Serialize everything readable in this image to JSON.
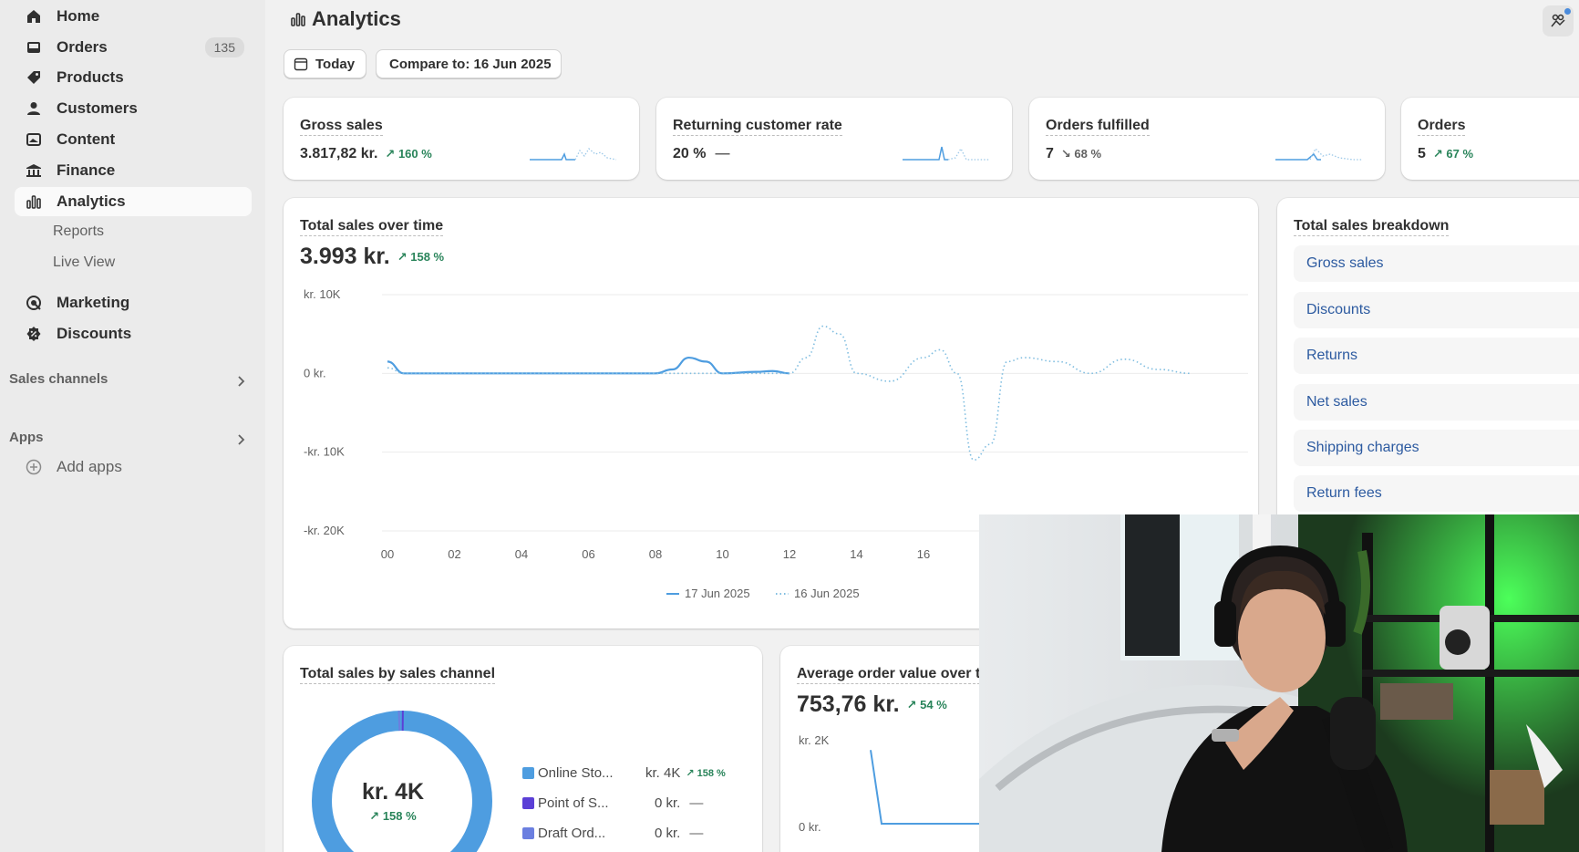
{
  "sidebar": {
    "items": [
      {
        "label": "Home",
        "icon": "home-icon"
      },
      {
        "label": "Orders",
        "icon": "inbox-icon",
        "badge": "135"
      },
      {
        "label": "Products",
        "icon": "tag-icon"
      },
      {
        "label": "Customers",
        "icon": "person-icon"
      },
      {
        "label": "Content",
        "icon": "image-icon"
      },
      {
        "label": "Finance",
        "icon": "bank-icon"
      },
      {
        "label": "Analytics",
        "icon": "bar-chart-icon",
        "active": true
      },
      {
        "label": "Marketing",
        "icon": "target-icon"
      },
      {
        "label": "Discounts",
        "icon": "discount-icon"
      }
    ],
    "sub_items": [
      "Reports",
      "Live View"
    ],
    "sales_channels_label": "Sales channels",
    "apps_label": "Apps",
    "add_apps_label": "Add apps"
  },
  "header": {
    "title": "Analytics",
    "date_button": "Today",
    "compare_button": "Compare to: 16 Jun 2025"
  },
  "metrics": [
    {
      "title": "Gross sales",
      "value": "3.817,82 kr.",
      "delta": "160 %",
      "trend": "up"
    },
    {
      "title": "Returning customer rate",
      "value": "20 %",
      "delta": "—",
      "trend": "flat"
    },
    {
      "title": "Orders fulfilled",
      "value": "7",
      "delta": "68 %",
      "trend": "down"
    },
    {
      "title": "Orders",
      "value": "5",
      "delta": "67 %",
      "trend": "up"
    }
  ],
  "total_sales": {
    "title": "Total sales over time",
    "value": "3.993 kr.",
    "delta": "158 %",
    "legend": [
      "17 Jun 2025",
      "16 Jun 2025"
    ]
  },
  "breakdown": {
    "title": "Total sales breakdown",
    "items": [
      "Gross sales",
      "Discounts",
      "Returns",
      "Net sales",
      "Shipping charges",
      "Return fees"
    ]
  },
  "by_channel": {
    "title": "Total sales by sales channel",
    "center_value": "kr. 4K",
    "center_delta": "158 %",
    "rows": [
      {
        "name": "Online Sto...",
        "value": "kr. 4K",
        "delta": "158 %",
        "color": "#4e9de0"
      },
      {
        "name": "Point of S...",
        "value": "0 kr.",
        "delta": "—",
        "color": "#5b3fd6"
      },
      {
        "name": "Draft Ord...",
        "value": "0 kr.",
        "delta": "—",
        "color": "#6b7fe0"
      }
    ]
  },
  "aov": {
    "title": "Average order value over t",
    "value": "753,76 kr.",
    "delta": "54 %",
    "y_labels": [
      "kr. 2K",
      "0 kr."
    ]
  },
  "chart_data": [
    {
      "type": "line",
      "title": "Total sales over time",
      "x": [
        "00",
        "02",
        "04",
        "06",
        "08",
        "10",
        "12",
        "14",
        "16"
      ],
      "y_ticks": [
        "kr. 10K",
        "0 kr.",
        "-kr. 10K",
        "-kr. 20K"
      ],
      "ylim": [
        -20000,
        10000
      ],
      "series": [
        {
          "name": "17 Jun 2025",
          "style": "solid",
          "color": "#4e9de0",
          "points": [
            [
              0,
              1500
            ],
            [
              0.5,
              0
            ],
            [
              2,
              0
            ],
            [
              4,
              0
            ],
            [
              6,
              0
            ],
            [
              8,
              0
            ],
            [
              8.5,
              500
            ],
            [
              9,
              2000
            ],
            [
              9.5,
              1500
            ],
            [
              10,
              0
            ],
            [
              11,
              200
            ],
            [
              11.5,
              300
            ],
            [
              12,
              0
            ]
          ]
        },
        {
          "name": "16 Jun 2025",
          "style": "dotted",
          "color": "#7fbde0",
          "points": [
            [
              0,
              700
            ],
            [
              0.5,
              0
            ],
            [
              2,
              0
            ],
            [
              4,
              0
            ],
            [
              6,
              0
            ],
            [
              8,
              0
            ],
            [
              9,
              0
            ],
            [
              10,
              0
            ],
            [
              11,
              0
            ],
            [
              12,
              0
            ],
            [
              12.5,
              2000
            ],
            [
              13,
              6000
            ],
            [
              13.5,
              5000
            ],
            [
              14,
              0
            ],
            [
              15,
              -1000
            ],
            [
              16,
              2000
            ],
            [
              16.5,
              3000
            ],
            [
              17,
              0
            ],
            [
              17.5,
              -11000
            ],
            [
              18,
              -9000
            ],
            [
              18.5,
              1500
            ],
            [
              19,
              2000
            ],
            [
              20,
              1500
            ],
            [
              21,
              0
            ],
            [
              22,
              1800
            ],
            [
              23,
              500
            ],
            [
              24,
              0
            ]
          ]
        }
      ]
    },
    {
      "type": "pie",
      "title": "Total sales by sales channel",
      "categories": [
        "Online Sto...",
        "Point of S...",
        "Draft Ord..."
      ],
      "values": [
        4000,
        0,
        0
      ]
    },
    {
      "type": "line",
      "title": "Average order value over t",
      "y_ticks": [
        "kr. 2K",
        "0 kr."
      ],
      "series": [
        {
          "name": "17 Jun 2025",
          "points": [
            [
              0,
              1700
            ],
            [
              0.2,
              0
            ],
            [
              1,
              0
            ],
            [
              3,
              0
            ]
          ]
        }
      ]
    }
  ]
}
